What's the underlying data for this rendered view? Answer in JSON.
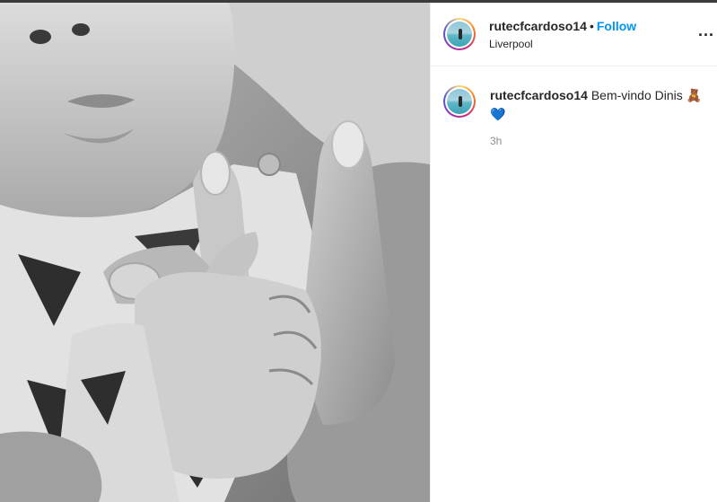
{
  "post": {
    "image_description": "",
    "photo_tone": "monochrome"
  },
  "header": {
    "username": "rutecfcardoso14",
    "separator": "•",
    "follow_label": "Follow",
    "location": "Liverpool",
    "more_label": "..."
  },
  "caption": {
    "username": "rutecfcardoso14",
    "text": "Bem-vindo Dinis",
    "emoji_bear": "🧸",
    "emoji_heart": "💙",
    "time": "3h"
  },
  "colors": {
    "follow": "#0095f6",
    "text": "#262626",
    "muted": "#8e8e8e"
  }
}
